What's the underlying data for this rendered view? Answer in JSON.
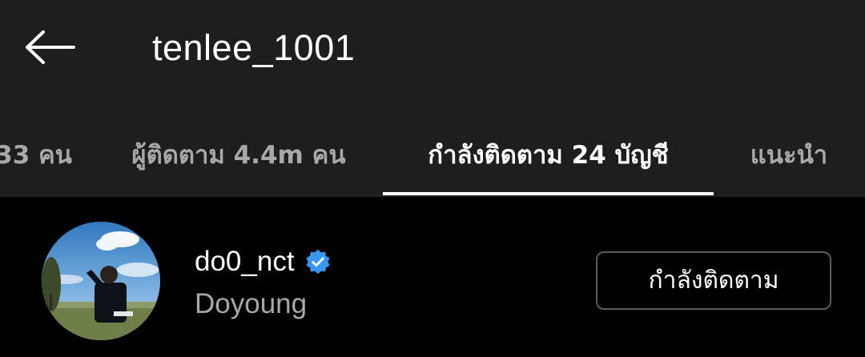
{
  "header": {
    "title": "tenlee_1001",
    "back_icon": "arrow-left-icon"
  },
  "tabs": [
    {
      "label": "33 คน"
    },
    {
      "label": "ผู้ติดตาม 4.4m คน"
    },
    {
      "label": "กำลังติดตาม 24 บัญชี"
    },
    {
      "label": "แนะนำ"
    }
  ],
  "active_tab": "กำลังติดตาม 24 บัญชี",
  "list": {
    "items": [
      {
        "username": "do0_nct",
        "full_name": "Doyoung",
        "verified": true,
        "button_label": "กำลังติดตาม"
      }
    ]
  },
  "colors": {
    "topbar_bg": "#1e1e1e",
    "page_bg": "#000000",
    "verified_blue": "#3897f0",
    "muted_text": "#a8a8a8"
  }
}
